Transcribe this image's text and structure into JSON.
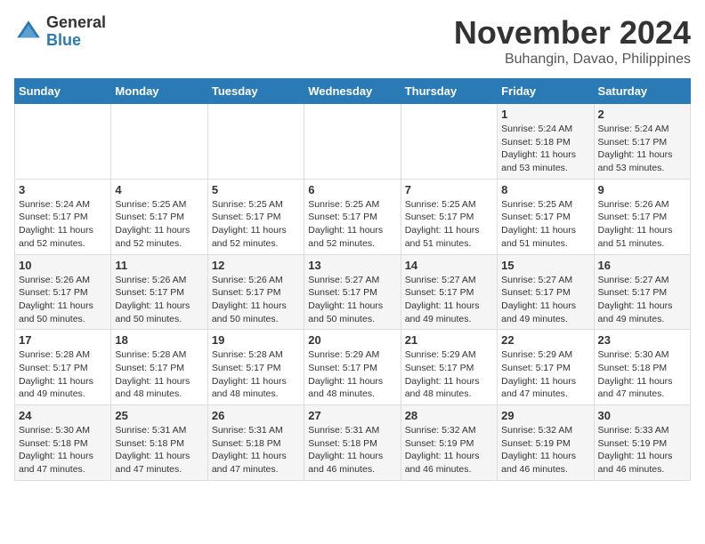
{
  "logo": {
    "general": "General",
    "blue": "Blue"
  },
  "header": {
    "month": "November 2024",
    "location": "Buhangin, Davao, Philippines"
  },
  "weekdays": [
    "Sunday",
    "Monday",
    "Tuesday",
    "Wednesday",
    "Thursday",
    "Friday",
    "Saturday"
  ],
  "weeks": [
    [
      {
        "day": "",
        "info": ""
      },
      {
        "day": "",
        "info": ""
      },
      {
        "day": "",
        "info": ""
      },
      {
        "day": "",
        "info": ""
      },
      {
        "day": "",
        "info": ""
      },
      {
        "day": "1",
        "info": "Sunrise: 5:24 AM\nSunset: 5:18 PM\nDaylight: 11 hours\nand 53 minutes."
      },
      {
        "day": "2",
        "info": "Sunrise: 5:24 AM\nSunset: 5:17 PM\nDaylight: 11 hours\nand 53 minutes."
      }
    ],
    [
      {
        "day": "3",
        "info": "Sunrise: 5:24 AM\nSunset: 5:17 PM\nDaylight: 11 hours\nand 52 minutes."
      },
      {
        "day": "4",
        "info": "Sunrise: 5:25 AM\nSunset: 5:17 PM\nDaylight: 11 hours\nand 52 minutes."
      },
      {
        "day": "5",
        "info": "Sunrise: 5:25 AM\nSunset: 5:17 PM\nDaylight: 11 hours\nand 52 minutes."
      },
      {
        "day": "6",
        "info": "Sunrise: 5:25 AM\nSunset: 5:17 PM\nDaylight: 11 hours\nand 52 minutes."
      },
      {
        "day": "7",
        "info": "Sunrise: 5:25 AM\nSunset: 5:17 PM\nDaylight: 11 hours\nand 51 minutes."
      },
      {
        "day": "8",
        "info": "Sunrise: 5:25 AM\nSunset: 5:17 PM\nDaylight: 11 hours\nand 51 minutes."
      },
      {
        "day": "9",
        "info": "Sunrise: 5:26 AM\nSunset: 5:17 PM\nDaylight: 11 hours\nand 51 minutes."
      }
    ],
    [
      {
        "day": "10",
        "info": "Sunrise: 5:26 AM\nSunset: 5:17 PM\nDaylight: 11 hours\nand 50 minutes."
      },
      {
        "day": "11",
        "info": "Sunrise: 5:26 AM\nSunset: 5:17 PM\nDaylight: 11 hours\nand 50 minutes."
      },
      {
        "day": "12",
        "info": "Sunrise: 5:26 AM\nSunset: 5:17 PM\nDaylight: 11 hours\nand 50 minutes."
      },
      {
        "day": "13",
        "info": "Sunrise: 5:27 AM\nSunset: 5:17 PM\nDaylight: 11 hours\nand 50 minutes."
      },
      {
        "day": "14",
        "info": "Sunrise: 5:27 AM\nSunset: 5:17 PM\nDaylight: 11 hours\nand 49 minutes."
      },
      {
        "day": "15",
        "info": "Sunrise: 5:27 AM\nSunset: 5:17 PM\nDaylight: 11 hours\nand 49 minutes."
      },
      {
        "day": "16",
        "info": "Sunrise: 5:27 AM\nSunset: 5:17 PM\nDaylight: 11 hours\nand 49 minutes."
      }
    ],
    [
      {
        "day": "17",
        "info": "Sunrise: 5:28 AM\nSunset: 5:17 PM\nDaylight: 11 hours\nand 49 minutes."
      },
      {
        "day": "18",
        "info": "Sunrise: 5:28 AM\nSunset: 5:17 PM\nDaylight: 11 hours\nand 48 minutes."
      },
      {
        "day": "19",
        "info": "Sunrise: 5:28 AM\nSunset: 5:17 PM\nDaylight: 11 hours\nand 48 minutes."
      },
      {
        "day": "20",
        "info": "Sunrise: 5:29 AM\nSunset: 5:17 PM\nDaylight: 11 hours\nand 48 minutes."
      },
      {
        "day": "21",
        "info": "Sunrise: 5:29 AM\nSunset: 5:17 PM\nDaylight: 11 hours\nand 48 minutes."
      },
      {
        "day": "22",
        "info": "Sunrise: 5:29 AM\nSunset: 5:17 PM\nDaylight: 11 hours\nand 47 minutes."
      },
      {
        "day": "23",
        "info": "Sunrise: 5:30 AM\nSunset: 5:18 PM\nDaylight: 11 hours\nand 47 minutes."
      }
    ],
    [
      {
        "day": "24",
        "info": "Sunrise: 5:30 AM\nSunset: 5:18 PM\nDaylight: 11 hours\nand 47 minutes."
      },
      {
        "day": "25",
        "info": "Sunrise: 5:31 AM\nSunset: 5:18 PM\nDaylight: 11 hours\nand 47 minutes."
      },
      {
        "day": "26",
        "info": "Sunrise: 5:31 AM\nSunset: 5:18 PM\nDaylight: 11 hours\nand 47 minutes."
      },
      {
        "day": "27",
        "info": "Sunrise: 5:31 AM\nSunset: 5:18 PM\nDaylight: 11 hours\nand 46 minutes."
      },
      {
        "day": "28",
        "info": "Sunrise: 5:32 AM\nSunset: 5:19 PM\nDaylight: 11 hours\nand 46 minutes."
      },
      {
        "day": "29",
        "info": "Sunrise: 5:32 AM\nSunset: 5:19 PM\nDaylight: 11 hours\nand 46 minutes."
      },
      {
        "day": "30",
        "info": "Sunrise: 5:33 AM\nSunset: 5:19 PM\nDaylight: 11 hours\nand 46 minutes."
      }
    ]
  ]
}
